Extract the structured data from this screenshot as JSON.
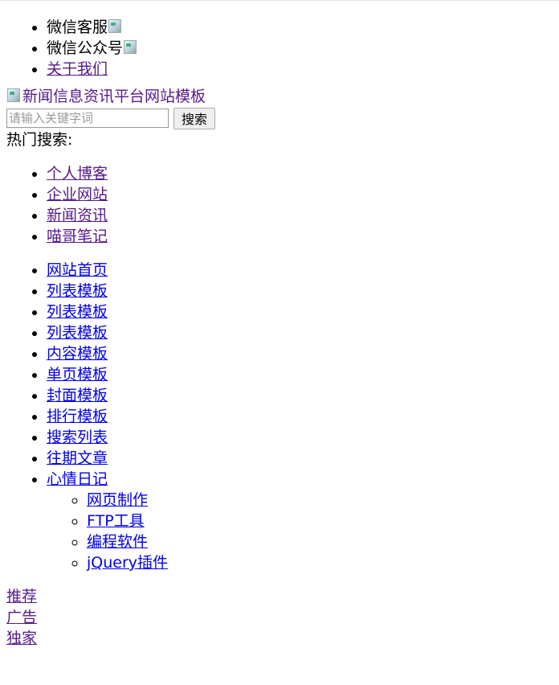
{
  "top_links": [
    {
      "label": "微信客服",
      "icon": "qr-code-image"
    },
    {
      "label": "微信公众号",
      "icon": "qr-code-image"
    },
    {
      "label": "关于我们"
    }
  ],
  "logo": {
    "alt": "新闻信息资讯平台网站模板"
  },
  "search": {
    "placeholder": "请输入关键字词",
    "value": "",
    "button_label": "搜索"
  },
  "hot": {
    "label": "热门搜索:",
    "items": [
      "个人博客",
      "企业网站",
      "新闻资讯",
      "喵哥笔记"
    ]
  },
  "nav": {
    "items": [
      "网站首页",
      "列表模板",
      "列表模板",
      "列表模板",
      "内容模板",
      "单页模板",
      "封面模板",
      "排行模板",
      "搜索列表",
      "往期文章",
      "心情日记"
    ],
    "sub_items": [
      "网页制作",
      "FTP工具",
      "编程软件",
      "jQuery插件"
    ]
  },
  "tags": [
    "推荐",
    "广告",
    "独家"
  ],
  "colors": {
    "link": "#0000ee",
    "visited": "#551a8b",
    "text": "#000000"
  }
}
